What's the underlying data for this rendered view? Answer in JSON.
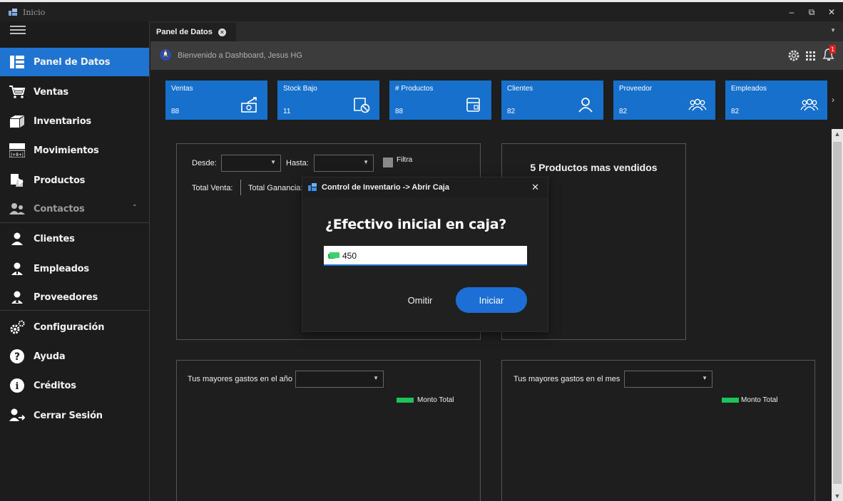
{
  "window": {
    "title": "Inicio",
    "minimize": "–",
    "maximize": "⧉",
    "close": "✕"
  },
  "sidebar": {
    "items": [
      {
        "label": "Panel de Datos"
      },
      {
        "label": "Ventas"
      },
      {
        "label": "Inventarios"
      },
      {
        "label": "Movimientos"
      },
      {
        "label": "Productos"
      },
      {
        "label": "Contactos"
      },
      {
        "label": "Clientes"
      },
      {
        "label": "Empleados"
      },
      {
        "label": "Proveedores"
      },
      {
        "label": "Configuración"
      },
      {
        "label": "Ayuda"
      },
      {
        "label": "Créditos"
      },
      {
        "label": "Cerrar Sesión"
      }
    ]
  },
  "tab": {
    "label": "Panel de Datos"
  },
  "header": {
    "welcome": "Bienvenido a Dashboard, Jesus HG",
    "notification_count": "1"
  },
  "kpis": [
    {
      "title": "Ventas",
      "value": "88"
    },
    {
      "title": "Stock Bajo",
      "value": "11"
    },
    {
      "title": "# Productos",
      "value": "88"
    },
    {
      "title": "Clientes",
      "value": "82"
    },
    {
      "title": "Proveedor",
      "value": "82"
    },
    {
      "title": "Empleados",
      "value": "82"
    }
  ],
  "filters": {
    "desde_label": "Desde:",
    "hasta_label": "Hasta:",
    "filtra_label": "Filtra",
    "total_venta_label": "Total Venta:",
    "total_ganancia_label": "Total Ganancia:"
  },
  "top_products": {
    "title": "5 Productos mas vendidos"
  },
  "expenses_year": {
    "label": "Tus mayores gastos en el año",
    "legend": "Monto Total"
  },
  "expenses_month": {
    "label": "Tus mayores gastos en el  mes",
    "legend": "Monto Total"
  },
  "dialog": {
    "title": "Control de Inventario -> Abrir Caja",
    "question": "¿Efectivo inicial en caja?",
    "input_value": "450",
    "skip_label": "Omitir",
    "start_label": "Iniciar",
    "close": "✕"
  },
  "colors": {
    "accent": "#1e74d0",
    "kpi": "#1670cc",
    "legend": "#1ec25b",
    "sidebar_bg": "#1c1c1c"
  }
}
